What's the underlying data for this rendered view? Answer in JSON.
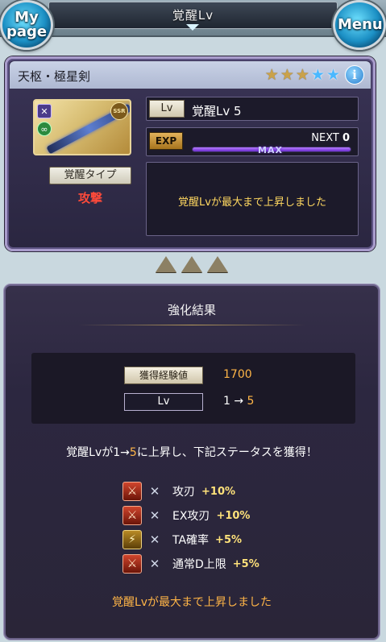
{
  "header": {
    "title": "覚醒Lv",
    "left_button": "My\npage",
    "right_button": "Menu"
  },
  "weapon": {
    "name": "天枢・極星剣",
    "stars": [
      {
        "type": "gold",
        "icon": "star-gold"
      },
      {
        "type": "gold",
        "icon": "star-gold"
      },
      {
        "type": "gold",
        "icon": "star-gold"
      },
      {
        "type": "blue",
        "icon": "star-blue"
      },
      {
        "type": "blue",
        "icon": "star-blue"
      }
    ],
    "rarity_badge": "SSR",
    "awakening_type_label": "覚醒タイプ",
    "awakening_type_value": "攻撃",
    "lv_tag": "Lv",
    "lv_text": "覚醒Lv 5",
    "exp_tag": "EXP",
    "next_label": "NEXT",
    "next_value": "0",
    "exp_fill": 1.0,
    "max_label": "MAX",
    "message": "覚醒Lvが最大まで上昇しました"
  },
  "colors": {
    "accent_orange": "#ffb547",
    "message_yellow": "#ffd860",
    "attack_red": "#ff4a3a"
  },
  "result": {
    "title": "強化結果",
    "exp_label": "獲得経験値",
    "exp_value": "1700",
    "lv_label": "Lv",
    "lv_from": "1 → ",
    "lv_to": "5",
    "gain_prefix": "覚醒Lvが",
    "gain_from": "1→",
    "gain_to": "5",
    "gain_suffix": "に上昇し、下記ステータスを獲得！",
    "skills": [
      {
        "name": "攻刃",
        "value": "+10%",
        "icon": "fire-skill-icon"
      },
      {
        "name": "EX攻刃",
        "value": "+10%",
        "icon": "fire-skill-icon"
      },
      {
        "name": "TA確率",
        "value": "+5%",
        "icon": "gold-skill-icon"
      },
      {
        "name": "通常D上限",
        "value": "+5%",
        "icon": "fire-skill-icon"
      }
    ],
    "final_message": "覚醒Lvが最大まで上昇しました"
  }
}
